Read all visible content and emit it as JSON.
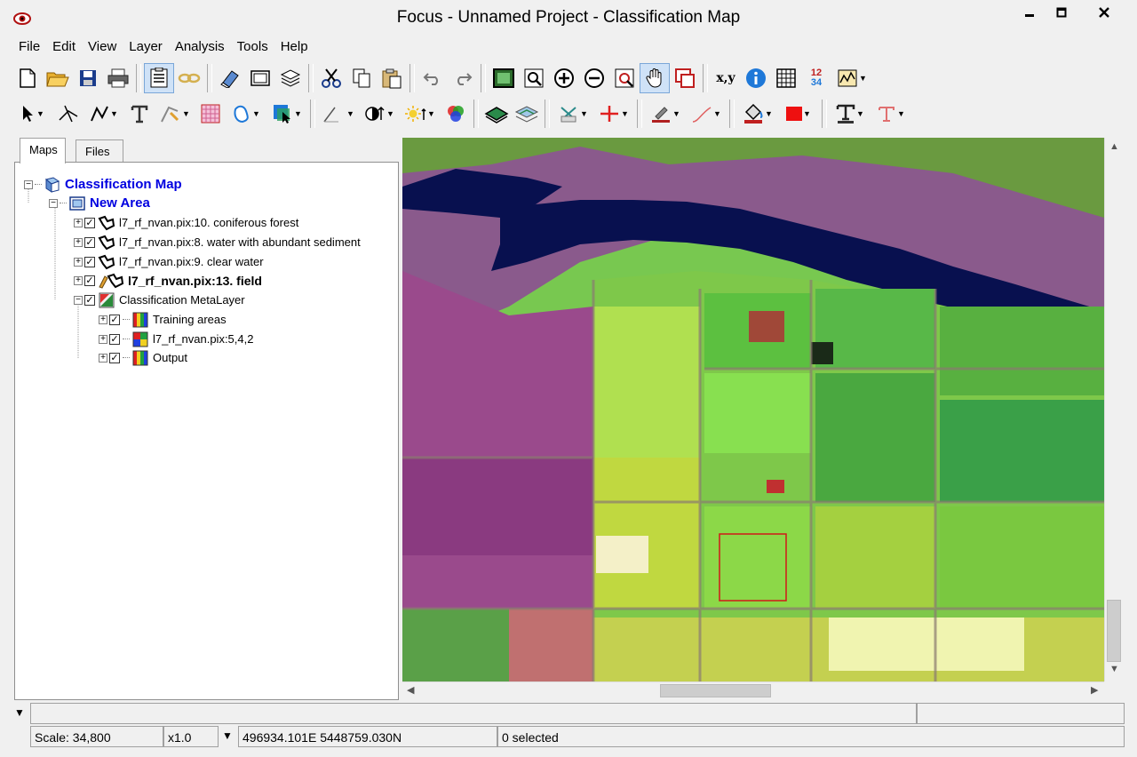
{
  "window": {
    "title": "Focus - Unnamed Project - Classification Map",
    "minimize_icon": "minimize-icon",
    "maximize_icon": "maximize-icon",
    "close_icon": "close-icon"
  },
  "menu": [
    "File",
    "Edit",
    "View",
    "Layer",
    "Analysis",
    "Tools",
    "Help"
  ],
  "panel": {
    "tabs": [
      "Maps",
      "Files"
    ],
    "active_tab": "Maps"
  },
  "tree": {
    "map": "Classification Map",
    "area": "New Area",
    "layers": [
      "l7_rf_nvan.pix:10. coniferous forest",
      "l7_rf_nvan.pix:8. water with abundant sediment",
      "l7_rf_nvan.pix:9. clear water",
      "l7_rf_nvan.pix:13. field"
    ],
    "metalayer": "Classification MetaLayer",
    "sublayers": [
      "Training areas",
      "l7_rf_nvan.pix:5,4,2",
      "Output"
    ]
  },
  "toolbar1": {
    "coord_label": "x,y",
    "numbers_label_top": "12",
    "numbers_label_bottom": "34"
  },
  "status": {
    "scale": "Scale: 34,800",
    "zoom": "x1.0",
    "coords": "496934.101E 5448759.030N",
    "selected": "0 selected"
  },
  "colors": {
    "map_water": "#08104f",
    "map_field": "#7ee04a",
    "map_urban": "#9a4a8c",
    "selection_box": "#d01818",
    "tree_link_blue": "#0000e0"
  }
}
